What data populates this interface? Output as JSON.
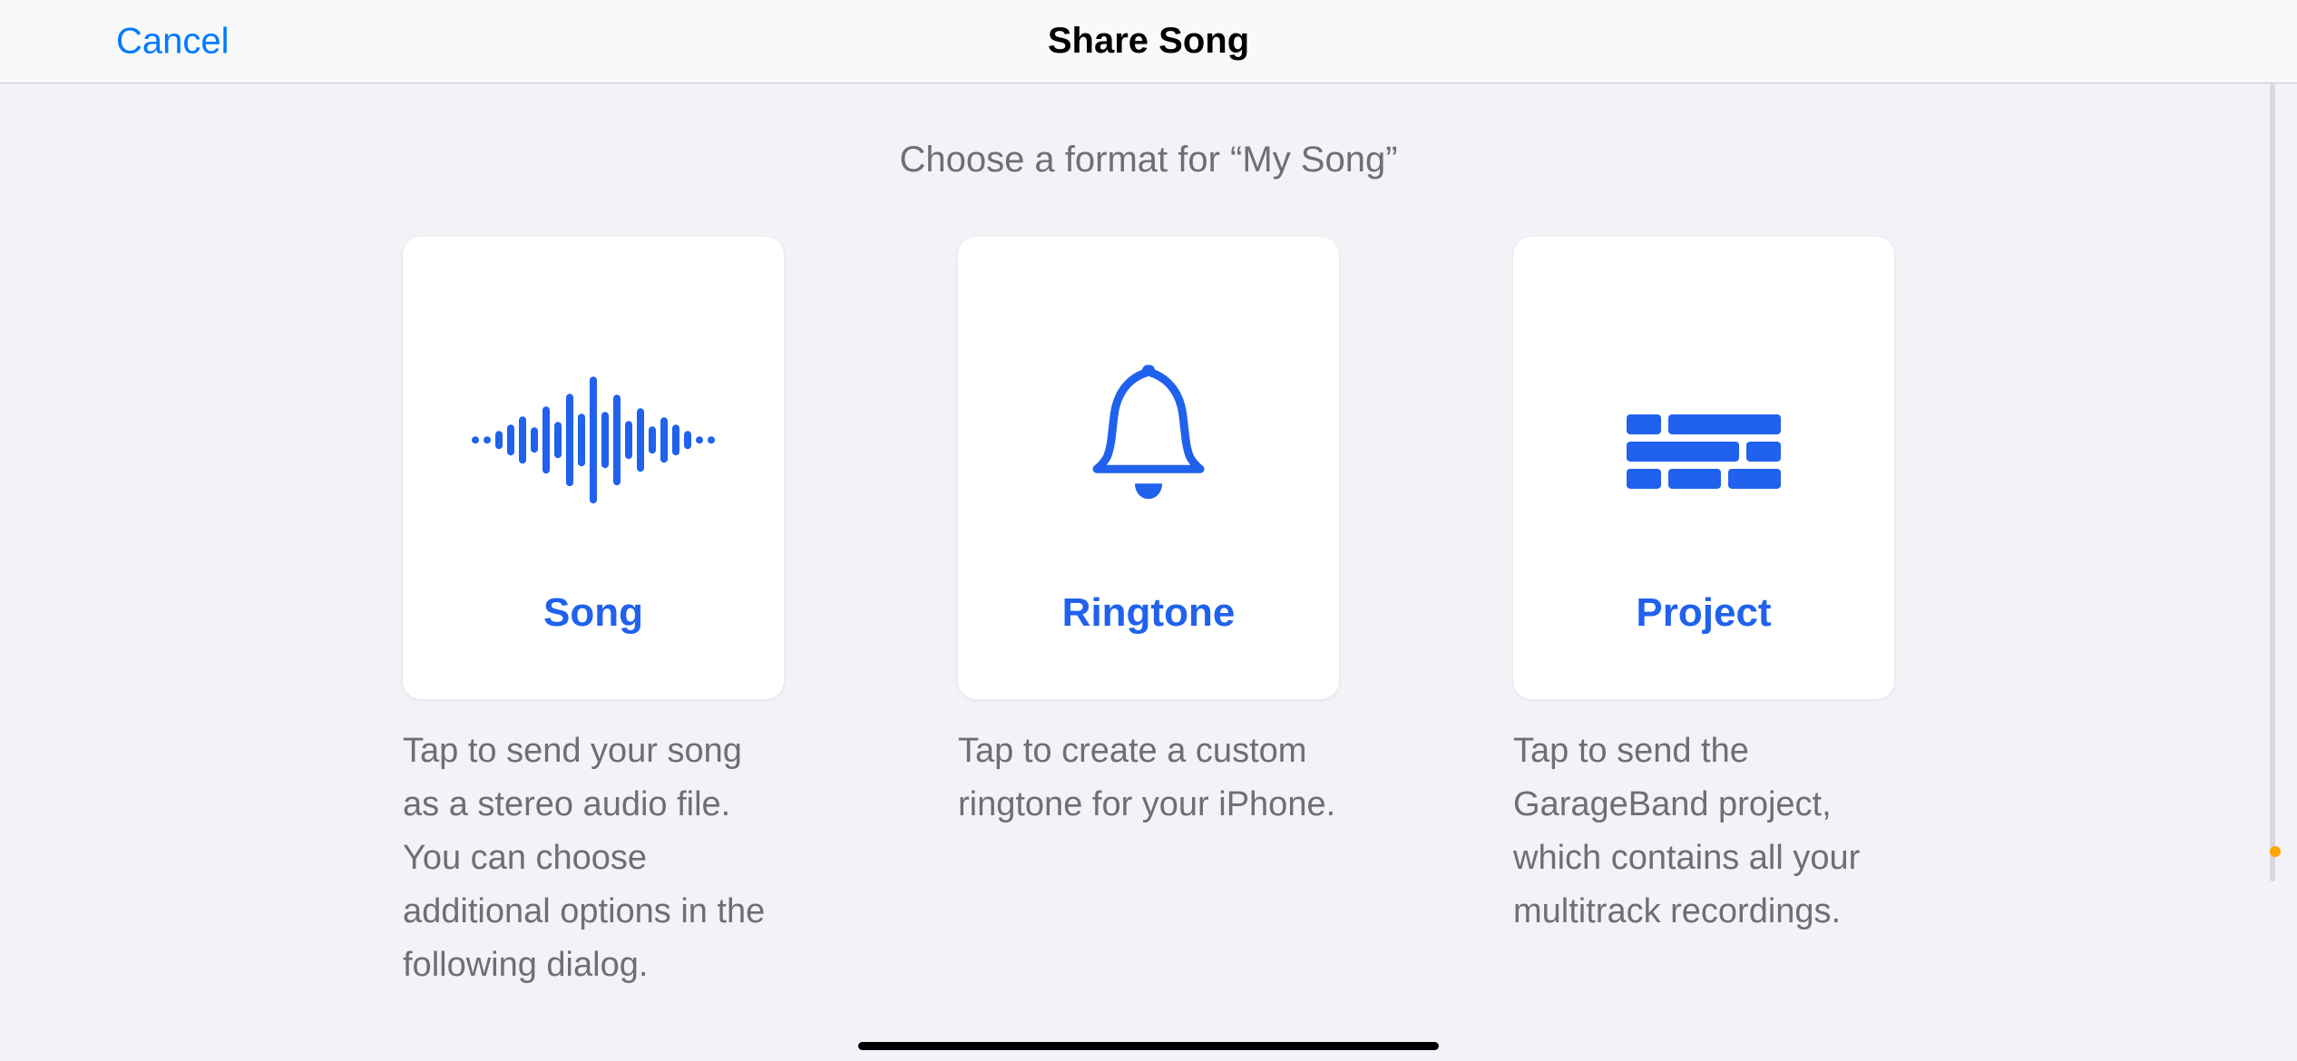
{
  "nav": {
    "cancel": "Cancel",
    "title": "Share Song"
  },
  "subtitle": "Choose a format for “My Song”",
  "options": {
    "song": {
      "label": "Song",
      "description": "Tap to send your song as a stereo audio file. You can choose additional options in the following dialog.",
      "icon": "waveform-icon"
    },
    "ringtone": {
      "label": "Ringtone",
      "description": "Tap to create a custom ringtone for your iPhone.",
      "icon": "bell-icon"
    },
    "project": {
      "label": "Project",
      "description": "Tap to send the GarageBand project, which contains all your multitrack recordings.",
      "icon": "bricks-icon"
    }
  },
  "colors": {
    "accent": "#2061ed",
    "link": "#007aff",
    "background": "#f2f2f7",
    "card": "#ffffff",
    "text_secondary": "#6e6e73"
  }
}
